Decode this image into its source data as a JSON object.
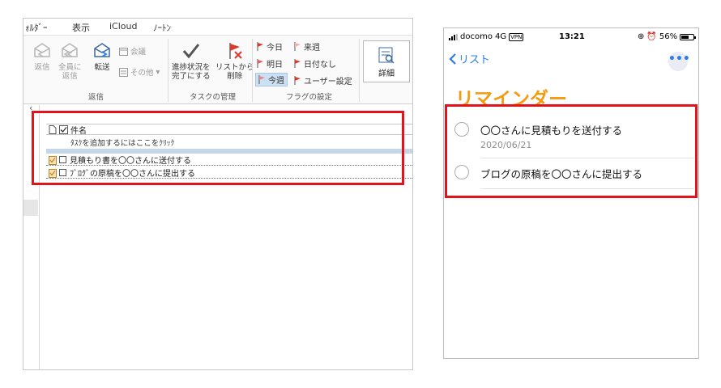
{
  "outlook": {
    "menu": [
      "ｫﾙﾀﾞｰ",
      "表示",
      "iCloud",
      "ﾉｰﾄﾝ"
    ],
    "reply_group": {
      "reply": "返信",
      "reply_all_1": "全員に",
      "reply_all_2": "返信",
      "forward": "転送",
      "meeting": "会議",
      "other": "その他",
      "label": "返信"
    },
    "task_group": {
      "complete_1": "進捗状況を",
      "complete_2": "完了にする",
      "remove_1": "リストから",
      "remove_2": "削除",
      "label": "タスクの管理"
    },
    "flag_group": {
      "today": "今日",
      "tomorrow": "明日",
      "this_week": "今週",
      "next_week": "来週",
      "no_date": "日付なし",
      "custom": "ユーザー設定",
      "label": "フラグの設定"
    },
    "details": "詳細",
    "list": {
      "subject_header": "件名",
      "add_placeholder": "ﾀｽｸを追加するにはここをｸﾘｯｸ",
      "tasks": [
        "見積もり書を〇〇さんに送付する",
        "ﾌﾞﾛｸﾞの原稿を〇〇さんに提出する"
      ]
    }
  },
  "phone": {
    "status": {
      "carrier": "docomo",
      "network": "4G",
      "vpn": "VPN",
      "time": "13:21",
      "battery": "56%"
    },
    "nav": {
      "back_label": "リスト",
      "more": "•••"
    },
    "title": "リマインダー",
    "reminders": [
      {
        "title": "〇〇さんに見積もりを送付する",
        "date": "2020/06/21"
      },
      {
        "title": "ブログの原稿を〇〇さんに提出する",
        "date": ""
      }
    ]
  },
  "colors": {
    "highlight_border": "#e3131b",
    "reminders_title": "#f39c12",
    "ios_blue": "#2b7de9",
    "flag_red": "#d83a2e"
  }
}
